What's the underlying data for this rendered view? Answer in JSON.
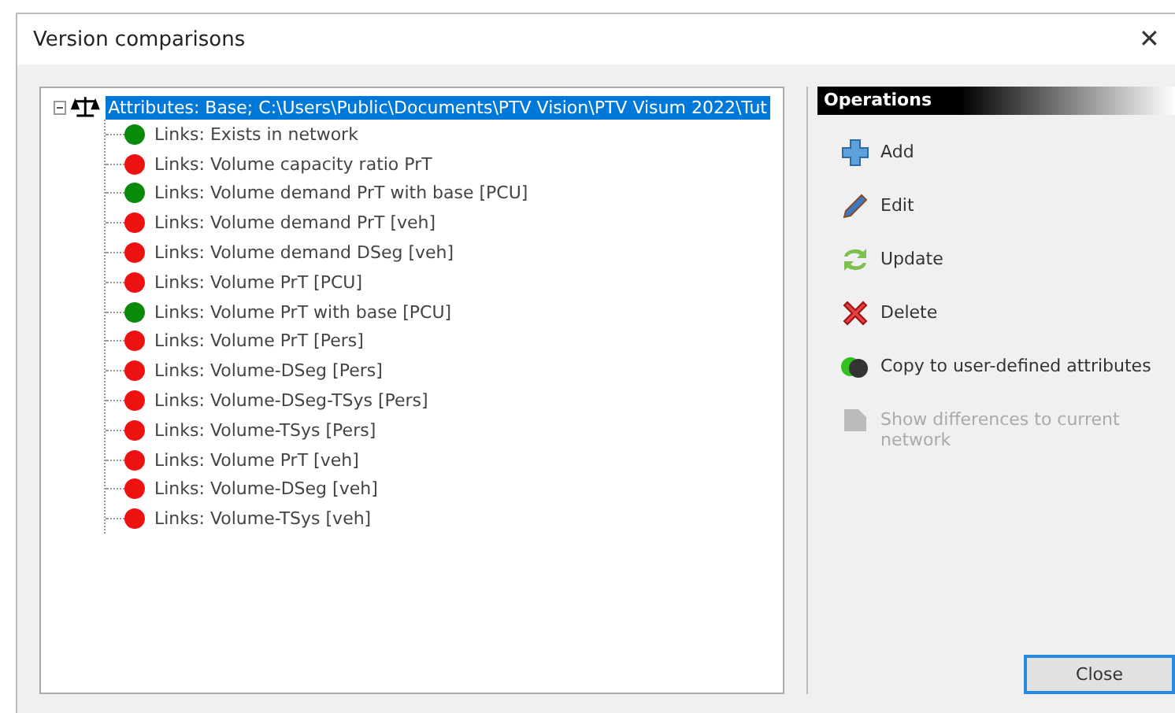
{
  "window": {
    "title": "Version comparisons",
    "close_glyph": "✕"
  },
  "tree": {
    "root": {
      "label": "Attributes: Base; C:\\Users\\Public\\Documents\\PTV Vision\\PTV Visum 2022\\Tut",
      "expanded": true,
      "selected": true,
      "children": [
        {
          "label": "Links: Exists in network",
          "color": "#0a8a0a"
        },
        {
          "label": "Links: Volume capacity ratio PrT",
          "color": "#ee1111"
        },
        {
          "label": "Links: Volume demand PrT with base [PCU]",
          "color": "#0a8a0a"
        },
        {
          "label": "Links: Volume demand  PrT [veh]",
          "color": "#ee1111"
        },
        {
          "label": "Links: Volume demand DSeg [veh]",
          "color": "#ee1111"
        },
        {
          "label": "Links: Volume PrT [PCU]",
          "color": "#ee1111"
        },
        {
          "label": "Links: Volume PrT with base [PCU]",
          "color": "#0a8a0a"
        },
        {
          "label": "Links: Volume PrT [Pers]",
          "color": "#ee1111"
        },
        {
          "label": "Links: Volume-DSeg [Pers]",
          "color": "#ee1111"
        },
        {
          "label": "Links: Volume-DSeg-TSys [Pers]",
          "color": "#ee1111"
        },
        {
          "label": "Links: Volume-TSys [Pers]",
          "color": "#ee1111"
        },
        {
          "label": "Links: Volume PrT [veh]",
          "color": "#ee1111"
        },
        {
          "label": "Links: Volume-DSeg [veh]",
          "color": "#ee1111"
        },
        {
          "label": "Links: Volume-TSys [veh]",
          "color": "#ee1111"
        }
      ]
    }
  },
  "operations": {
    "title": "Operations",
    "items": [
      {
        "kind": "add",
        "label": "Add",
        "disabled": false
      },
      {
        "kind": "edit",
        "label": "Edit",
        "disabled": false
      },
      {
        "kind": "update",
        "label": "Update",
        "disabled": false
      },
      {
        "kind": "delete",
        "label": "Delete",
        "disabled": false
      },
      {
        "kind": "copy",
        "label": "Copy to user-defined attributes",
        "disabled": false
      },
      {
        "kind": "show",
        "label": "Show differences to current network",
        "disabled": true
      }
    ]
  },
  "buttons": [
    {
      "label": "Close"
    }
  ]
}
